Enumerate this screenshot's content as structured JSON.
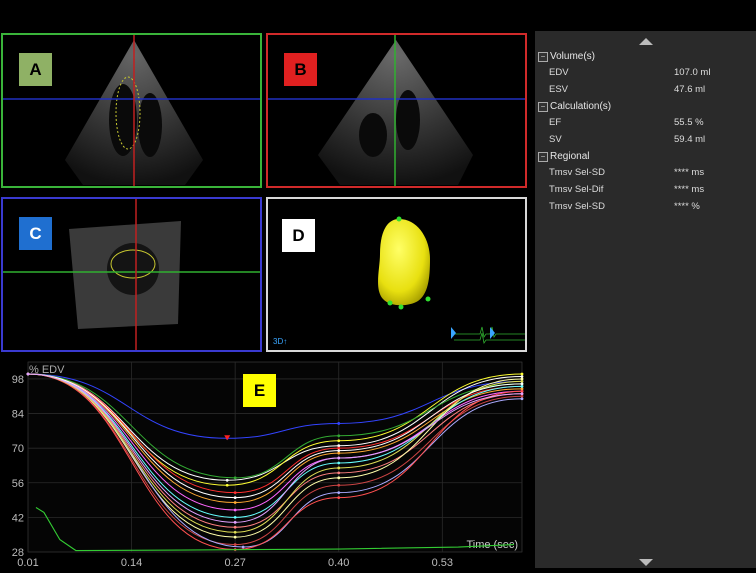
{
  "views": {
    "a": {
      "tag": "A",
      "tag_color": "#8fb165",
      "border": "#3ab43a"
    },
    "b": {
      "tag": "B",
      "tag_color": "#e02020",
      "border": "#d02a2a"
    },
    "c": {
      "tag": "C",
      "tag_color": "#1f6fd0",
      "border": "#3a3ad0"
    },
    "d": {
      "tag": "D",
      "tag_color": "#ffffff",
      "border": "#d8d8d8",
      "mode_label": "3D↑"
    },
    "e": {
      "tag": "E",
      "tag_color": "#ffff00"
    }
  },
  "panel": {
    "sections": [
      {
        "title": "Volume(s)",
        "rows": [
          {
            "label": "EDV",
            "value": "107.0 ml"
          },
          {
            "label": "ESV",
            "value": "47.6 ml"
          }
        ]
      },
      {
        "title": "Calculation(s)",
        "rows": [
          {
            "label": "EF",
            "value": "55.5 %"
          },
          {
            "label": "SV",
            "value": "59.4 ml"
          }
        ]
      },
      {
        "title": "Regional",
        "rows": [
          {
            "label": "Tmsv Sel-SD",
            "value": "**** ms"
          },
          {
            "label": "Tmsv Sel-Dif",
            "value": "**** ms"
          },
          {
            "label": "Tmsv Sel-SD",
            "value": "**** %"
          }
        ]
      }
    ],
    "collapse_glyph": "−",
    "scroll_up_icon": "triangle-up-icon",
    "scroll_down_icon": "triangle-down-icon"
  },
  "chart_data": {
    "type": "line",
    "title": "",
    "ylabel": "% EDV",
    "xlabel": "Time (sec)",
    "yticks": [
      98,
      84,
      70,
      56,
      42,
      28
    ],
    "xticks": [
      "0.01",
      "0.14",
      "0.27",
      "0.40",
      "0.53"
    ],
    "xlim": [
      0.01,
      0.63
    ],
    "ylim": [
      28,
      100
    ],
    "min_marker": {
      "x": 0.26,
      "y": 74,
      "color": "#ff2020"
    },
    "segment_curves": [
      {
        "color": "#3344ff",
        "values": [
          [
            0.01,
            100
          ],
          [
            0.26,
            74
          ],
          [
            0.4,
            80
          ],
          [
            0.63,
            97
          ]
        ]
      },
      {
        "color": "#ffffff",
        "values": [
          [
            0.01,
            100
          ],
          [
            0.26,
            57
          ],
          [
            0.4,
            71
          ],
          [
            0.63,
            99
          ]
        ]
      },
      {
        "color": "#ffff33",
        "values": [
          [
            0.01,
            100
          ],
          [
            0.26,
            55
          ],
          [
            0.4,
            73
          ],
          [
            0.63,
            100
          ]
        ]
      },
      {
        "color": "#ff3030",
        "values": [
          [
            0.01,
            100
          ],
          [
            0.27,
            52
          ],
          [
            0.4,
            70
          ],
          [
            0.63,
            95
          ]
        ]
      },
      {
        "color": "#33aa33",
        "values": [
          [
            0.01,
            100
          ],
          [
            0.27,
            58
          ],
          [
            0.4,
            75
          ],
          [
            0.63,
            96
          ]
        ]
      },
      {
        "color": "#ffaa33",
        "values": [
          [
            0.01,
            100
          ],
          [
            0.27,
            48
          ],
          [
            0.4,
            68
          ],
          [
            0.63,
            94
          ]
        ]
      },
      {
        "color": "#ff66ff",
        "values": [
          [
            0.01,
            100
          ],
          [
            0.27,
            45
          ],
          [
            0.4,
            66
          ],
          [
            0.63,
            93
          ]
        ]
      },
      {
        "color": "#66ffff",
        "values": [
          [
            0.01,
            100
          ],
          [
            0.27,
            42
          ],
          [
            0.4,
            64
          ],
          [
            0.63,
            95
          ]
        ]
      },
      {
        "color": "#ff8080",
        "values": [
          [
            0.01,
            100
          ],
          [
            0.27,
            38
          ],
          [
            0.4,
            60
          ],
          [
            0.63,
            92
          ]
        ]
      },
      {
        "color": "#ffffaa",
        "values": [
          [
            0.01,
            100
          ],
          [
            0.27,
            34
          ],
          [
            0.4,
            58
          ],
          [
            0.63,
            98
          ]
        ]
      },
      {
        "color": "#cc4444",
        "values": [
          [
            0.01,
            100
          ],
          [
            0.27,
            31
          ],
          [
            0.4,
            55
          ],
          [
            0.63,
            91
          ]
        ]
      },
      {
        "color": "#aaaaff",
        "values": [
          [
            0.01,
            100
          ],
          [
            0.28,
            30
          ],
          [
            0.4,
            52
          ],
          [
            0.63,
            90
          ]
        ]
      },
      {
        "color": "#ff5050",
        "values": [
          [
            0.01,
            100
          ],
          [
            0.27,
            29
          ],
          [
            0.4,
            50
          ],
          [
            0.63,
            93
          ]
        ]
      },
      {
        "color": "#dddd55",
        "values": [
          [
            0.01,
            100
          ],
          [
            0.27,
            36
          ],
          [
            0.4,
            62
          ],
          [
            0.63,
            97
          ]
        ]
      },
      {
        "color": "#ffffff",
        "values": [
          [
            0.01,
            100
          ],
          [
            0.27,
            50
          ],
          [
            0.4,
            69
          ],
          [
            0.63,
            96
          ]
        ]
      },
      {
        "color": "#e0a0ff",
        "values": [
          [
            0.01,
            100
          ],
          [
            0.27,
            40
          ],
          [
            0.4,
            66
          ],
          [
            0.63,
            92
          ]
        ]
      }
    ],
    "ecg": {
      "color": "#33cc33",
      "values": [
        [
          0.02,
          46
        ],
        [
          0.03,
          44
        ],
        [
          0.05,
          33
        ],
        [
          0.07,
          28.6
        ],
        [
          0.2,
          28.8
        ],
        [
          0.4,
          29.2
        ],
        [
          0.55,
          30
        ],
        [
          0.62,
          31
        ]
      ]
    }
  }
}
